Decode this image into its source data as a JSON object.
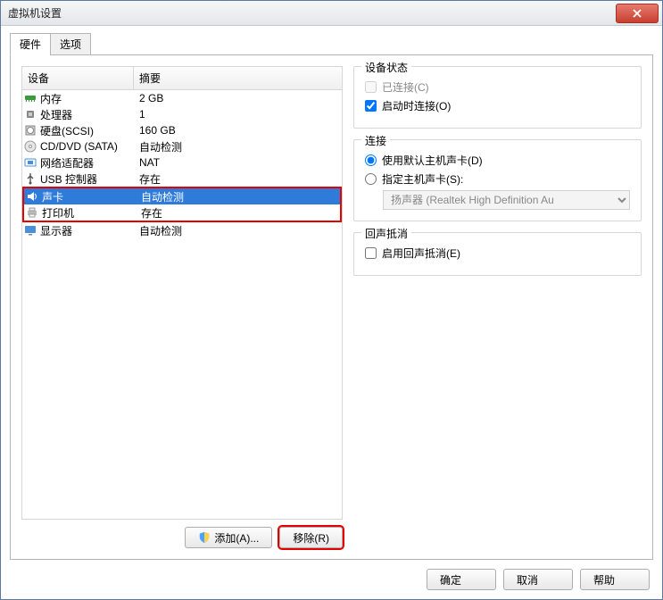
{
  "window": {
    "title": "虚拟机设置"
  },
  "tabs": [
    {
      "label": "硬件",
      "active": true
    },
    {
      "label": "选项",
      "active": false
    }
  ],
  "headers": {
    "device": "设备",
    "summary": "摘要"
  },
  "devices": [
    {
      "id": "memory",
      "name": "内存",
      "summary": "2 GB",
      "selected": false,
      "group": 0
    },
    {
      "id": "cpu",
      "name": "处理器",
      "summary": "1",
      "selected": false,
      "group": 0
    },
    {
      "id": "disk",
      "name": "硬盘(SCSI)",
      "summary": "160 GB",
      "selected": false,
      "group": 0
    },
    {
      "id": "dvd",
      "name": "CD/DVD (SATA)",
      "summary": "自动检测",
      "selected": false,
      "group": 0
    },
    {
      "id": "net",
      "name": "网络适配器",
      "summary": "NAT",
      "selected": false,
      "group": 0
    },
    {
      "id": "usb",
      "name": "USB 控制器",
      "summary": "存在",
      "selected": false,
      "group": 0
    },
    {
      "id": "sound",
      "name": "声卡",
      "summary": "自动检测",
      "selected": true,
      "group": 1
    },
    {
      "id": "printer",
      "name": "打印机",
      "summary": "存在",
      "selected": false,
      "group": 1
    },
    {
      "id": "display",
      "name": "显示器",
      "summary": "自动检测",
      "selected": false,
      "group": 2
    }
  ],
  "buttons": {
    "add": "添加(A)...",
    "remove": "移除(R)",
    "ok": "确定",
    "cancel": "取消",
    "help": "帮助"
  },
  "panel": {
    "status": {
      "title": "设备状态",
      "connected": "已连接(C)",
      "connectAtPower": "启动时连接(O)",
      "connectedChecked": false,
      "connectAtPowerChecked": true
    },
    "connection": {
      "title": "连接",
      "useDefault": "使用默认主机声卡(D)",
      "specify": "指定主机声卡(S):",
      "selected": "default",
      "dropdown": "扬声器 (Realtek High Definition Au"
    },
    "echo": {
      "title": "回声抵消",
      "enable": "启用回声抵消(E)",
      "checked": false
    }
  }
}
